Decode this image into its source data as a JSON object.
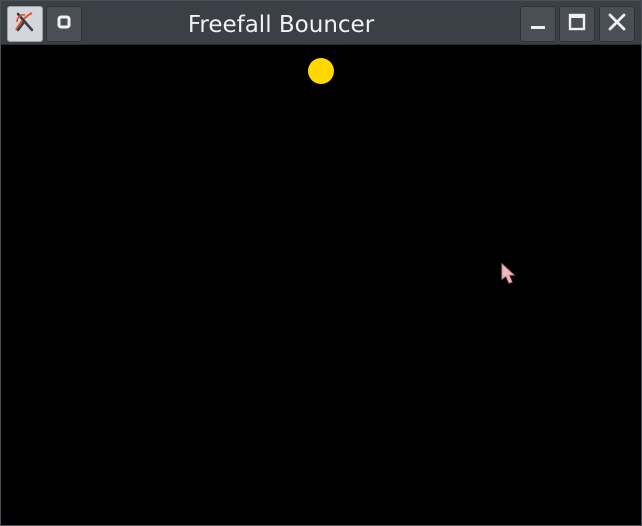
{
  "window": {
    "title": "Freefall Bouncer"
  },
  "titlebar_buttons": {
    "app_menu": "app-menu-icon",
    "pin": "pin-icon",
    "minimize": "minimize-icon",
    "maximize": "maximize-icon",
    "close": "close-icon"
  },
  "colors": {
    "titlebar_bg": "#3b4046",
    "canvas_bg": "#000000",
    "ball": "#ffd800",
    "cursor": "#f4b6be",
    "title_text": "#f2f2f2"
  }
}
